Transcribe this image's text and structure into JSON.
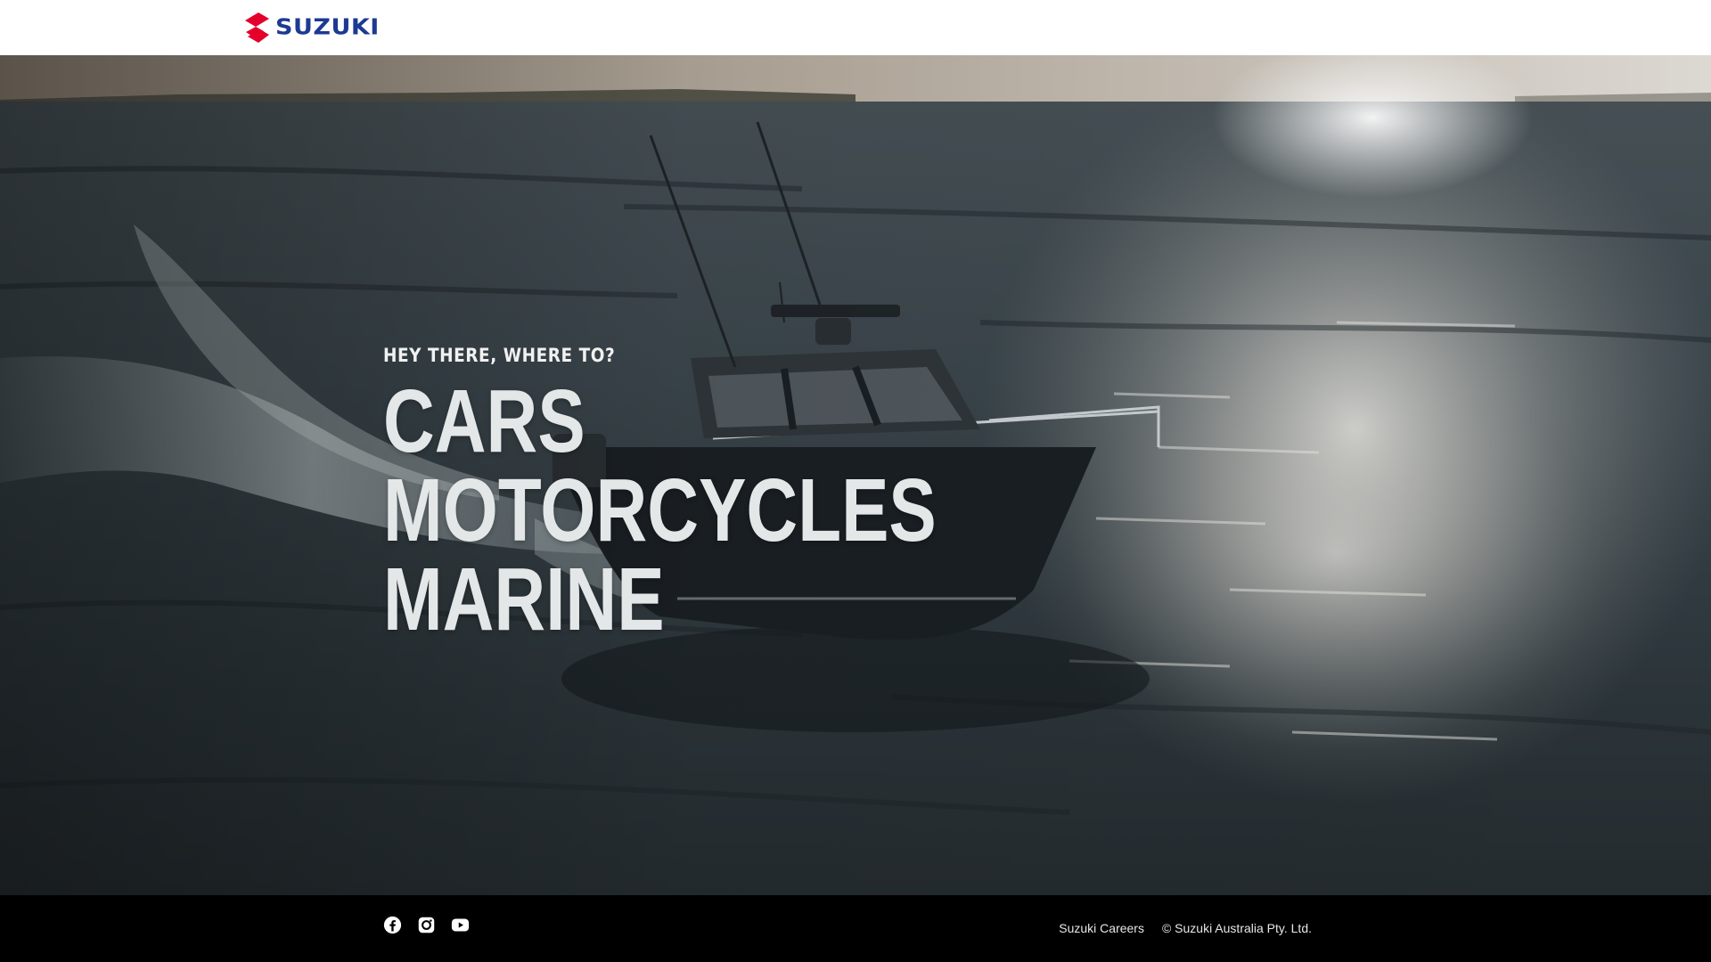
{
  "header": {
    "brand": "SUZUKI",
    "brand_color": "#1c3a92",
    "logo_mark_color": "#e4002b",
    "logo_icon": "suzuki-s-icon"
  },
  "hero": {
    "eyebrow": "HEY THERE, WHERE TO?",
    "links": [
      {
        "label": "CARS"
      },
      {
        "label": "MOTORCYCLES"
      },
      {
        "label": "MARINE"
      }
    ],
    "background": "boat-on-ocean-image"
  },
  "footer": {
    "social": [
      {
        "icon": "facebook-icon"
      },
      {
        "icon": "instagram-icon"
      },
      {
        "icon": "youtube-icon"
      }
    ],
    "careers_label": "Suzuki Careers",
    "copyright": "© Suzuki Australia Pty. Ltd."
  }
}
